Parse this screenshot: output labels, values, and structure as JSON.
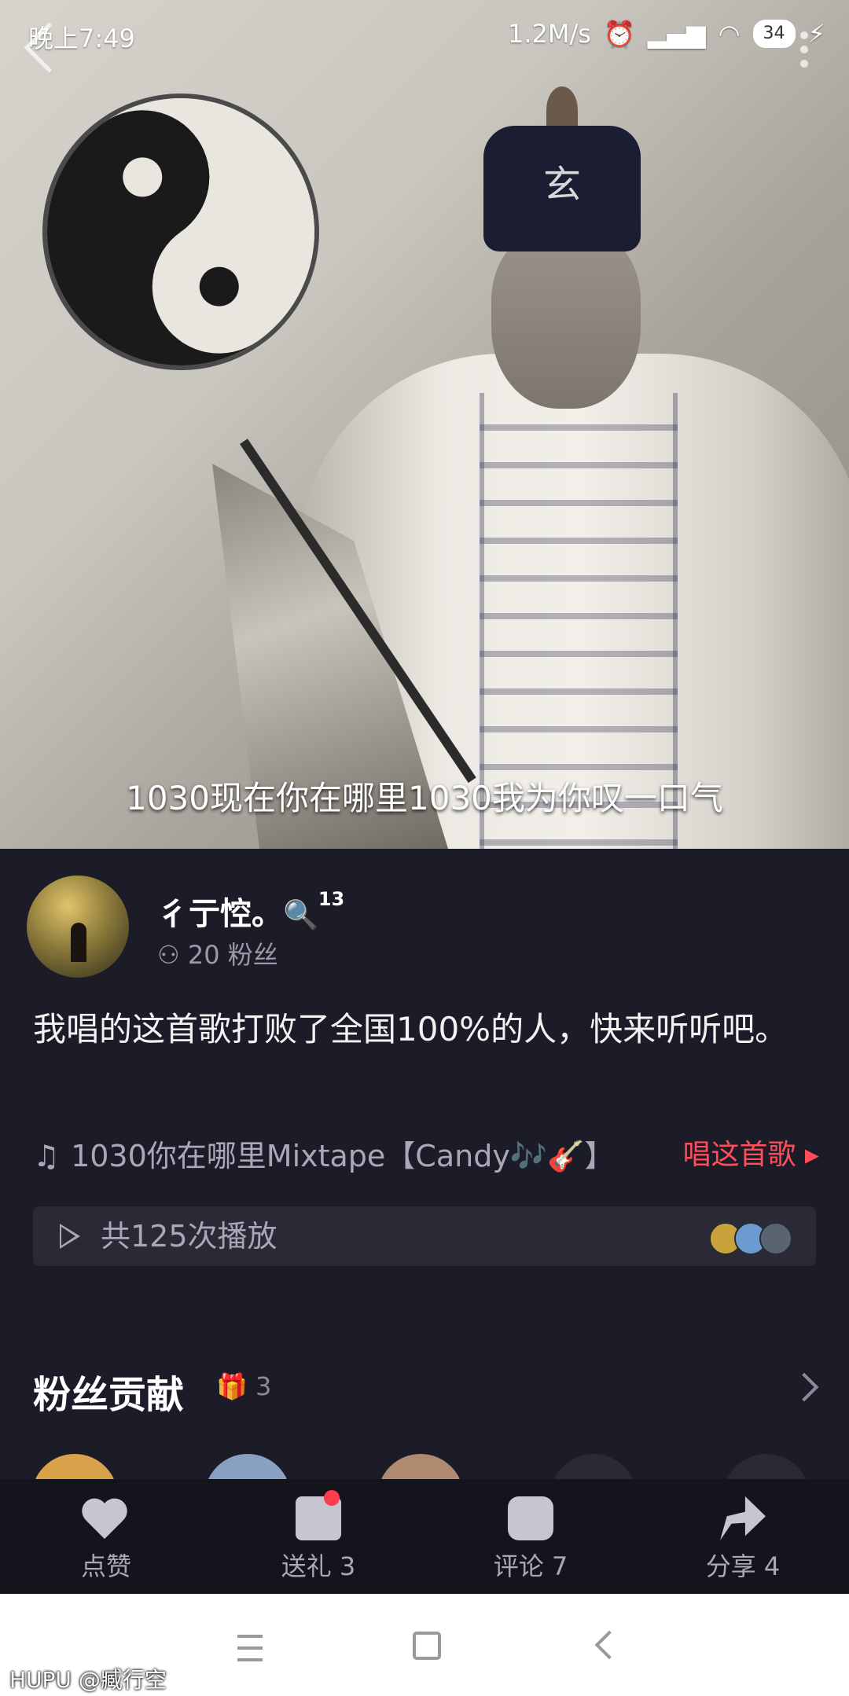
{
  "status_bar": {
    "time": "晚上7:49",
    "speed": "1.2M/s",
    "battery": "34"
  },
  "media": {
    "subtitle": "1030现在你在哪里1030我为你叹一口气",
    "hat_char": "玄"
  },
  "user": {
    "name": "彳亍悾。",
    "level_badge": "🔍",
    "level": "13",
    "fans": "20 粉丝"
  },
  "description": "我唱的这首歌打败了全国100%的人，快来听听吧。",
  "song": {
    "title": "1030你在哪里Mixtape【Candy🎶🎸】",
    "sing_label": "唱这首歌 ▸"
  },
  "play": {
    "count_label": "共125次播放"
  },
  "fans_section": {
    "title": "粉丝贡献",
    "gift_count": "3"
  },
  "actions": [
    {
      "label": "点赞"
    },
    {
      "label": "送礼 3"
    },
    {
      "label": "评论 7"
    },
    {
      "label": "分享 4"
    }
  ],
  "watermark": "HUPU @臧行空"
}
